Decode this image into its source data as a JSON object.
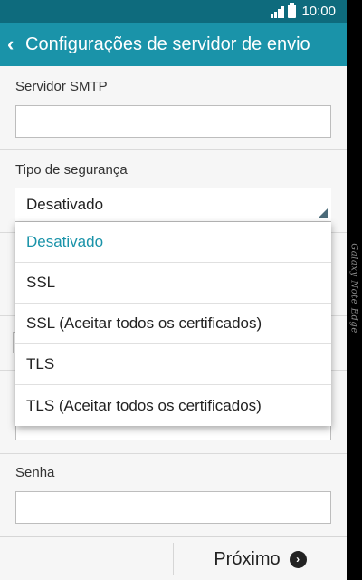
{
  "status_bar": {
    "time": "10:00"
  },
  "action_bar": {
    "back_icon": "‹",
    "title": "Configurações de servidor de envio"
  },
  "smtp": {
    "label": "Servidor SMTP",
    "value": ""
  },
  "security": {
    "label": "Tipo de segurança",
    "selected": "Desativado",
    "options": [
      "Desativado",
      "SSL",
      "SSL (Aceitar todos os certificados)",
      "TLS",
      "TLS (Aceitar todos os certificados)"
    ]
  },
  "password": {
    "label": "Senha",
    "value": ""
  },
  "bottom": {
    "next_label": "Próximo",
    "next_icon": "›"
  },
  "device": {
    "edge_label": "Galaxy Note Edge"
  },
  "colors": {
    "status_bar": "#0e6b7d",
    "action_bar": "#1a93a9",
    "selected_option": "#1a93a9"
  }
}
